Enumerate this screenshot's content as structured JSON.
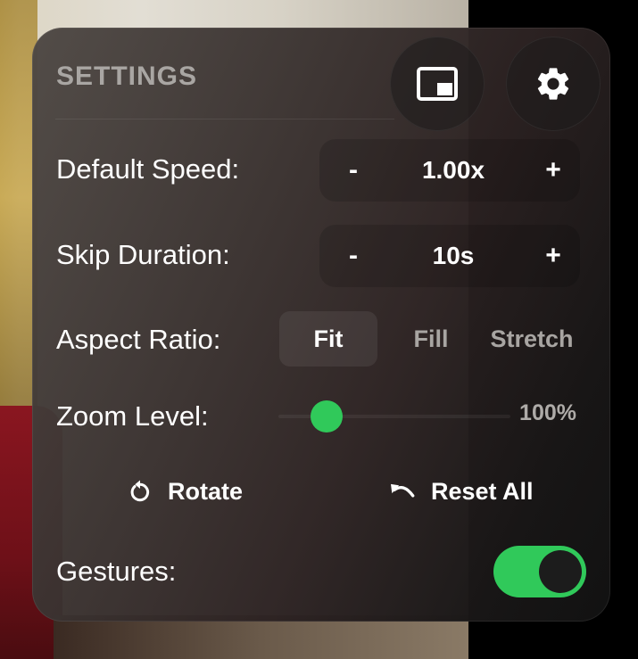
{
  "settings": {
    "title": "SETTINGS",
    "icons": {
      "pip": "picture-in-picture-icon",
      "gear": "gear-icon",
      "rotate": "rotate-icon",
      "reset": "undo-icon"
    },
    "default_speed": {
      "label": "Default Speed:",
      "value": "1.00x",
      "decrement": "-",
      "increment": "+"
    },
    "skip_duration": {
      "label": "Skip Duration:",
      "value": "10s",
      "decrement": "-",
      "increment": "+"
    },
    "aspect_ratio": {
      "label": "Aspect Ratio:",
      "options": [
        "Fit",
        "Fill",
        "Stretch"
      ],
      "selected": "Fit"
    },
    "zoom_level": {
      "label": "Zoom Level:",
      "value": "100%",
      "slider_position": 0
    },
    "actions": {
      "rotate": "Rotate",
      "reset_all": "Reset All"
    },
    "gestures": {
      "label": "Gestures:",
      "enabled": true
    },
    "colors": {
      "accent": "#30c95a",
      "panel": "#2e2a29",
      "muted_text": "#a9a6a3"
    }
  }
}
